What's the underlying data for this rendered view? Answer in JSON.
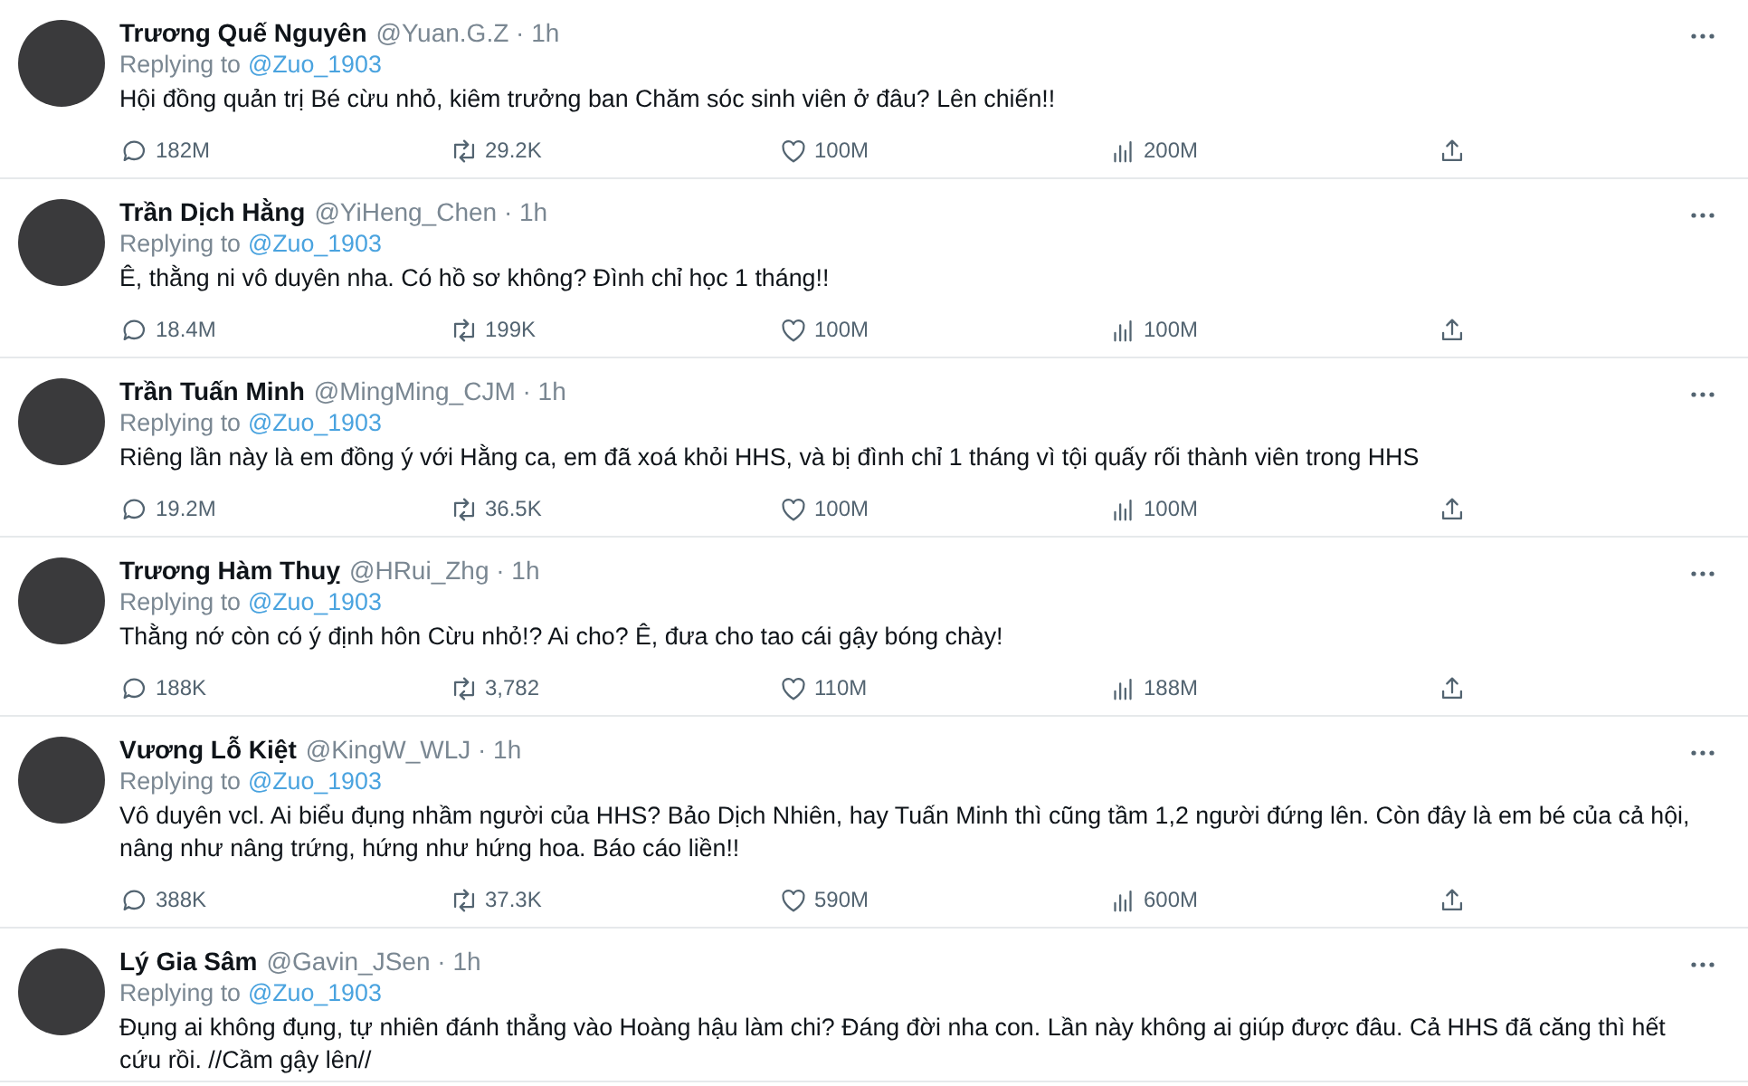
{
  "tweets": [
    {
      "name": "Trương Quế Nguyên",
      "meta": "@Yuan.G.Z · 1h",
      "replying_label": "Replying to",
      "reply_to": "@Zuo_1903",
      "text": "Hội đồng quản trị Bé cừu nhỏ, kiêm trưởng ban Chăm sóc sinh viên ở đâu? Lên chiến!!",
      "actions": {
        "replies": "182M",
        "retweets": "29.2K",
        "likes": "100M",
        "views": "200M"
      }
    },
    {
      "name": "Trần Dịch Hằng",
      "meta": "@YiHeng_Chen · 1h",
      "replying_label": "Replying to",
      "reply_to": "@Zuo_1903",
      "text": "Ê, thằng ni vô duyên nha. Có hồ sơ không? Đình chỉ học 1 tháng!!",
      "actions": {
        "replies": "18.4M",
        "retweets": "199K",
        "likes": "100M",
        "views": "100M"
      }
    },
    {
      "name": "Trần Tuấn Minh",
      "meta": "@MingMing_CJM · 1h",
      "replying_label": "Replying to",
      "reply_to": "@Zuo_1903",
      "text": "Riêng lần này là em đồng ý với Hằng ca, em đã xoá khỏi HHS, và bị đình chỉ 1 tháng vì tội quấy rối thành viên trong HHS",
      "actions": {
        "replies": "19.2M",
        "retweets": "36.5K",
        "likes": "100M",
        "views": "100M"
      }
    },
    {
      "name": "Trương Hàm Thuỵ",
      "meta": "@HRui_Zhg · 1h",
      "replying_label": "Replying to",
      "reply_to": "@Zuo_1903",
      "text": "Thằng nớ còn có ý định hôn Cừu nhỏ!? Ai cho? Ê, đưa cho tao cái gậy bóng chày!",
      "actions": {
        "replies": "188K",
        "retweets": "3,782",
        "likes": "110M",
        "views": "188M"
      }
    },
    {
      "name": "Vương Lỗ Kiệt",
      "meta": "@KingW_WLJ · 1h",
      "replying_label": "Replying to",
      "reply_to": "@Zuo_1903",
      "text": "Vô duyên vcl. Ai biểu đụng nhầm người của HHS? Bảo Dịch Nhiên, hay Tuấn Minh thì cũng tầm 1,2 người đứng lên. Còn đây là em bé của cả hội, nâng như nâng trứng, hứng như hứng hoa. Báo cáo liền!!",
      "actions": {
        "replies": "388K",
        "retweets": "37.3K",
        "likes": "590M",
        "views": "600M"
      }
    },
    {
      "name": "Lý Gia Sâm",
      "meta": "@Gavin_JSen · 1h",
      "replying_label": "Replying to",
      "reply_to": "@Zuo_1903",
      "text": "Đụng ai không đụng, tự nhiên đánh thẳng vào Hoàng hậu làm chi? Đáng đời nha con. Lần này không ai giúp được đâu. Cả HHS đã căng thì hết cứu rồi. //Cầm gậy lên//"
    }
  ]
}
